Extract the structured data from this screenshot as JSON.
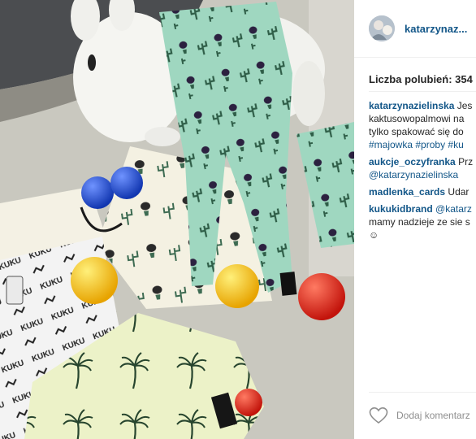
{
  "post": {
    "username": "katarzynaz...",
    "likes_text": "Liczba polubień: 354",
    "comments": [
      {
        "user": "katarzynazielinska",
        "lines": [
          [
            {
              "t": "text",
              "v": "Jes"
            }
          ],
          [
            {
              "t": "text",
              "v": "kaktusowopalmowi na"
            }
          ],
          [
            {
              "t": "text",
              "v": "tylko spakować się do"
            }
          ],
          [
            {
              "t": "tag",
              "v": "#majowka"
            },
            {
              "t": "text",
              "v": " "
            },
            {
              "t": "tag",
              "v": "#proby"
            },
            {
              "t": "text",
              "v": " "
            },
            {
              "t": "tag",
              "v": "#ku"
            }
          ]
        ]
      },
      {
        "user": "aukcje_oczyfranka",
        "lines": [
          [
            {
              "t": "text",
              "v": "Prz"
            }
          ],
          [
            {
              "t": "mention",
              "v": "@katarzynazielinska"
            }
          ]
        ]
      },
      {
        "user": "madlenka_cards",
        "lines": [
          [
            {
              "t": "text",
              "v": "Udar"
            }
          ]
        ]
      },
      {
        "user": "kukukidbrand",
        "lines": [
          [
            {
              "t": "mention",
              "v": "@katarz"
            }
          ],
          [
            {
              "t": "text",
              "v": "mamy nadzieje ze sie s"
            }
          ],
          [
            {
              "t": "text",
              "v": "☺"
            }
          ]
        ]
      }
    ],
    "add_comment_placeholder": "Dodaj komentarz"
  },
  "icons": {
    "avatar": "profile-avatar",
    "heart": "heart-icon"
  },
  "colors": {
    "username": "#125688",
    "text": "#262626",
    "muted": "#8e8e8e",
    "leggings": "#9fd7c0",
    "ball_blue": "#1f4fd0",
    "ball_yellow": "#f7c21a",
    "ball_red": "#e0261d"
  }
}
